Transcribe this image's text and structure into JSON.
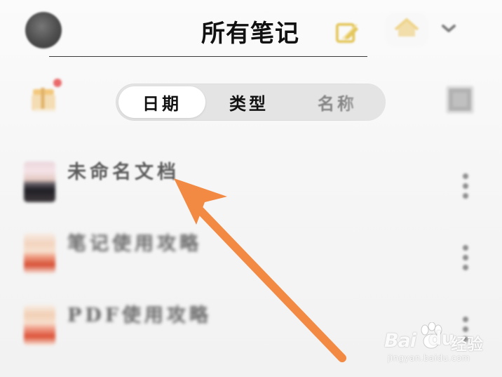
{
  "header": {
    "title": "所有笔记",
    "avatar_icon": "avatar-icon",
    "edit_icon": "edit-note-icon",
    "cloud_icon": "house-cloud-icon",
    "dropdown_icon": "chevron-down-icon"
  },
  "filters": {
    "left_icon": "gift-notification-icon",
    "tabs": [
      "日期",
      "类型",
      "名称"
    ],
    "selected": "日期",
    "sort_icon": "layout-grid-icon"
  },
  "notes": [
    {
      "title": "未命名文档",
      "thumb_icon": "note-thumbnail-icon",
      "more_icon": "more-vertical-icon"
    },
    {
      "title": "笔记使用攻略",
      "thumb_icon": "note-thumbnail-icon",
      "more_icon": "more-vertical-icon"
    },
    {
      "title": "PDF使用攻略",
      "thumb_icon": "note-thumbnail-icon",
      "more_icon": "more-vertical-icon"
    }
  ],
  "annotation": {
    "arrow_color": "#f28a43"
  },
  "watermark": {
    "brand_left": "Bai",
    "brand_right": "du",
    "brand_suffix": "经验",
    "url": "jingyan.baidu.com"
  },
  "colors": {
    "background": "#f4f4f4",
    "text": "#111111",
    "arrow": "#f28a43",
    "accent_icon": "#e7c15d"
  }
}
